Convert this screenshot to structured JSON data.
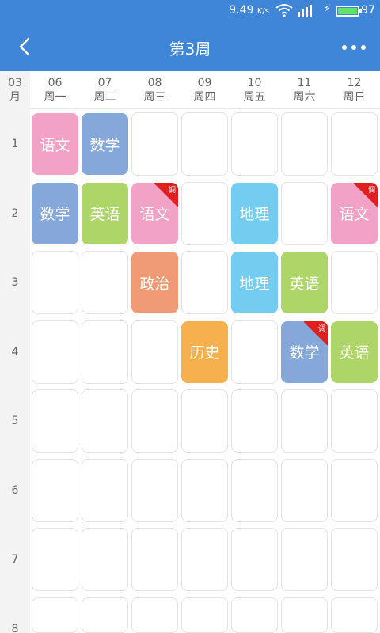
{
  "status_bar": {
    "speed": "9.49",
    "speed_unit": "K/s",
    "battery": "97",
    "battery_color": "#5ee26a"
  },
  "header": {
    "title": "第3周",
    "back_icon": "back-chevron-icon",
    "more_icon": "more-dots-icon",
    "bg_color": "#3f86d9"
  },
  "week": {
    "month_num": "03",
    "month_label": "月",
    "days": [
      {
        "date": "06",
        "weekday": "周一"
      },
      {
        "date": "07",
        "weekday": "周二"
      },
      {
        "date": "08",
        "weekday": "周三"
      },
      {
        "date": "09",
        "weekday": "周四"
      },
      {
        "date": "10",
        "weekday": "周五"
      },
      {
        "date": "11",
        "weekday": "周六"
      },
      {
        "date": "12",
        "weekday": "周日"
      }
    ]
  },
  "periods": [
    "1",
    "2",
    "3",
    "4",
    "5",
    "6",
    "7",
    "8"
  ],
  "tag_text": "调",
  "colors": {
    "chinese": "#f2a2c7",
    "math": "#85a7d9",
    "english": "#aed568",
    "geography": "#74cdf1",
    "politics": "#f09b76",
    "history": "#f6b04d",
    "tag": "#e02020"
  },
  "courses": [
    {
      "name": "语文",
      "day": 0,
      "period": 0,
      "color": "chinese",
      "tag": false
    },
    {
      "name": "数学",
      "day": 1,
      "period": 0,
      "color": "math",
      "tag": false
    },
    {
      "name": "数学",
      "day": 0,
      "period": 1,
      "color": "math",
      "tag": false
    },
    {
      "name": "英语",
      "day": 1,
      "period": 1,
      "color": "english",
      "tag": false
    },
    {
      "name": "语文",
      "day": 2,
      "period": 1,
      "color": "chinese",
      "tag": true
    },
    {
      "name": "地理",
      "day": 4,
      "period": 1,
      "color": "geography",
      "tag": false
    },
    {
      "name": "语文",
      "day": 6,
      "period": 1,
      "color": "chinese",
      "tag": true
    },
    {
      "name": "政治",
      "day": 2,
      "period": 2,
      "color": "politics",
      "tag": false
    },
    {
      "name": "地理",
      "day": 4,
      "period": 2,
      "color": "geography",
      "tag": false
    },
    {
      "name": "英语",
      "day": 5,
      "period": 2,
      "color": "english",
      "tag": false
    },
    {
      "name": "历史",
      "day": 3,
      "period": 3,
      "color": "history",
      "tag": false
    },
    {
      "name": "数学",
      "day": 5,
      "period": 3,
      "color": "math",
      "tag": true
    },
    {
      "name": "英语",
      "day": 6,
      "period": 3,
      "color": "english",
      "tag": false
    }
  ]
}
